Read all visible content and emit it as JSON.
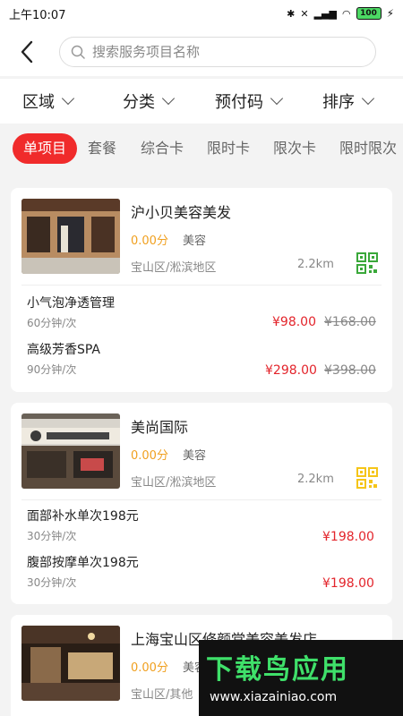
{
  "status": {
    "time": "上午10:07",
    "battery": "100"
  },
  "search": {
    "placeholder": "搜索服务项目名称"
  },
  "filters": [
    "区域",
    "分类",
    "预付码",
    "排序"
  ],
  "tabs": [
    "单项目",
    "套餐",
    "综合卡",
    "限时卡",
    "限次卡",
    "限时限次"
  ],
  "colors": {
    "accent": "#f02b2b",
    "price": "#e3242b",
    "score": "#f0a020",
    "qr_green": "#3aa83a",
    "qr_yellow": "#f5c518"
  },
  "shops": [
    {
      "name": "沪小贝美容美发",
      "score": "0.00分",
      "category": "美容",
      "area": "宝山区/淞滨地区",
      "distance": "2.2km",
      "qr_icon": "qr-code-green-icon",
      "services": [
        {
          "name": "小气泡净透管理",
          "duration": "60分钟/次",
          "price": "¥98.00",
          "original": "¥168.00"
        },
        {
          "name": "高级芳香SPA",
          "duration": "90分钟/次",
          "price": "¥298.00",
          "original": "¥398.00"
        }
      ]
    },
    {
      "name": "美尚国际",
      "score": "0.00分",
      "category": "美容",
      "area": "宝山区/淞滨地区",
      "distance": "2.2km",
      "qr_icon": "qr-code-yellow-icon",
      "services": [
        {
          "name": "面部补水单次198元",
          "duration": "30分钟/次",
          "price": "¥198.00"
        },
        {
          "name": "腹部按摩单次198元",
          "duration": "30分钟/次",
          "price": "¥198.00"
        }
      ]
    },
    {
      "name": "上海宝山区修颜堂美容美发店",
      "score": "0.00分",
      "category": "美容",
      "area": "宝山区/其他"
    }
  ],
  "watermark": {
    "title": "下载鸟应用",
    "url": "www.xiazainiao.com"
  }
}
